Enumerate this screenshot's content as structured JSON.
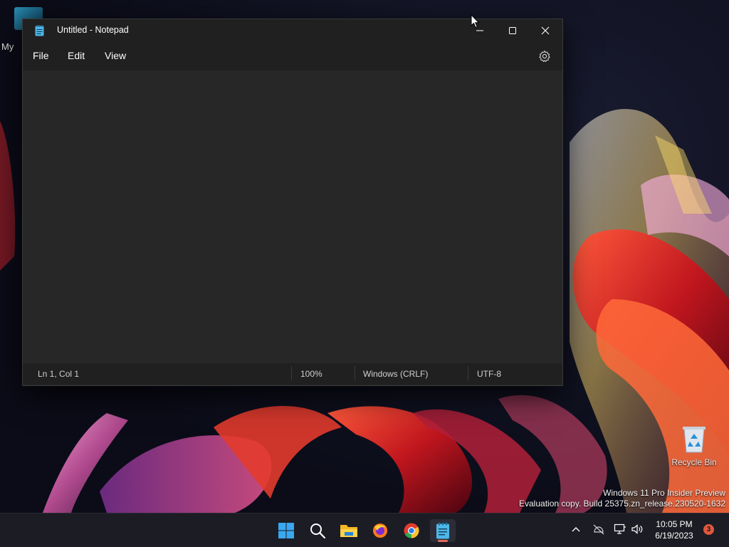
{
  "desktop": {
    "icons": [
      {
        "label": "My"
      },
      {
        "label": "Recycle Bin",
        "icon": "recycle-bin-icon"
      }
    ],
    "watermark": {
      "line1": "Windows 11 Pro Insider Preview",
      "line2": "Evaluation copy. Build 25375.zn_release.230520-1632"
    }
  },
  "window": {
    "title": "Untitled - Notepad",
    "app_icon": "notepad-icon",
    "controls": {
      "minimize": "minimize-icon",
      "maximize": "maximize-icon",
      "close": "close-icon"
    },
    "menu": [
      {
        "label": "File"
      },
      {
        "label": "Edit"
      },
      {
        "label": "View"
      }
    ],
    "settings_icon": "gear-icon",
    "editor_text": "",
    "status": {
      "position": "Ln 1, Col 1",
      "zoom": "100%",
      "line_ending": "Windows (CRLF)",
      "encoding": "UTF-8"
    }
  },
  "taskbar": {
    "apps": [
      {
        "name": "Start",
        "icon": "windows-start-icon"
      },
      {
        "name": "Search",
        "icon": "search-icon"
      },
      {
        "name": "File Explorer",
        "icon": "folder-icon"
      },
      {
        "name": "Firefox",
        "icon": "firefox-icon"
      },
      {
        "name": "Chrome",
        "icon": "chrome-icon"
      },
      {
        "name": "Notepad",
        "icon": "notepad-icon",
        "active": true
      }
    ],
    "tray": {
      "icons": [
        "chevron-up-icon",
        "network-off-icon",
        "display-icon",
        "volume-icon"
      ],
      "time": "10:05 PM",
      "date": "6/19/2023",
      "notification_count": "3"
    }
  },
  "colors": {
    "window_bg": "#272727",
    "chrome_bg": "#202020",
    "taskbar_bg": "#1c1c24",
    "accent_indicator": "#e06c5a",
    "badge": "#e0583e"
  }
}
